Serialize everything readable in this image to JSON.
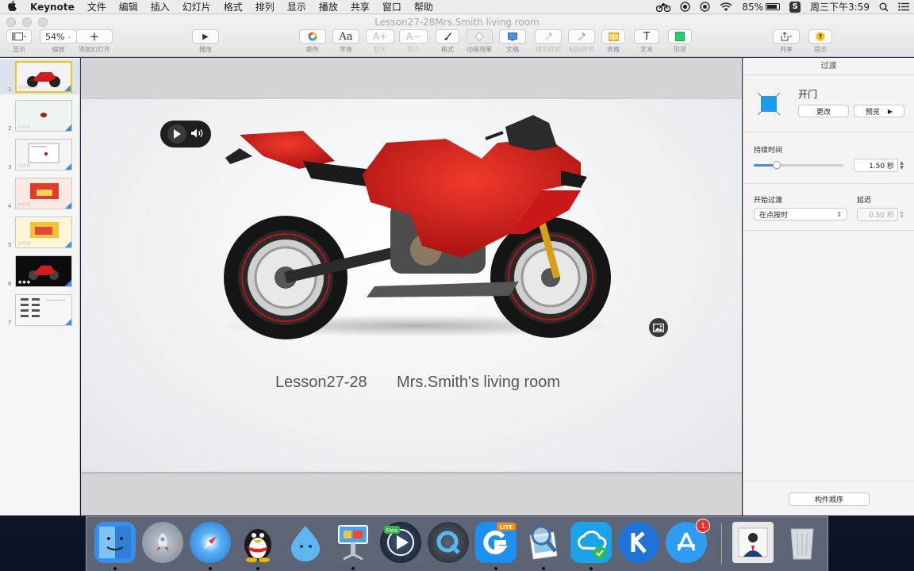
{
  "menubar": {
    "app_name": "Keynote",
    "items": [
      "文件",
      "编辑",
      "插入",
      "幻灯片",
      "格式",
      "排列",
      "显示",
      "播放",
      "共享",
      "窗口",
      "帮助"
    ],
    "battery_percent": "85%",
    "clock": "周三下午3:59"
  },
  "window": {
    "title": "Lesson27-28Mrs.Smith living room"
  },
  "toolbar": {
    "view_label": "显示",
    "zoom_value": "54%",
    "zoom_label": "缩放",
    "add_slide_label": "添加幻灯片",
    "play_label": "播放",
    "color_label": "颜色",
    "font_glyph": "Aa",
    "font_label": "字体",
    "bigger_glyph": "A+",
    "bigger_label": "较大",
    "smaller_glyph": "A−",
    "smaller_label": "较小",
    "format_label": "格式",
    "animate_label": "动画效果",
    "document_label": "文稿",
    "copy_style_label": "拷贝样式",
    "paste_style_label": "粘贴样式",
    "table_label": "表格",
    "text_glyph": "T",
    "text_label": "文本",
    "shape_label": "形状",
    "share_label": "共享",
    "tips_label": "提示"
  },
  "navigator": {
    "slides": [
      {
        "number": "1",
        "kind": "bike-light",
        "selected": true
      },
      {
        "number": "2",
        "kind": "dot",
        "selected": false
      },
      {
        "number": "3",
        "kind": "doc",
        "selected": false
      },
      {
        "number": "4",
        "kind": "red-room",
        "selected": false
      },
      {
        "number": "5",
        "kind": "yellow-room",
        "selected": false
      },
      {
        "number": "6",
        "kind": "bike-dark",
        "selected": false
      },
      {
        "number": "7",
        "kind": "grid",
        "selected": false
      }
    ]
  },
  "slide": {
    "text_lesson": "Lesson27-28",
    "text_title": "Mrs.Smith's living room"
  },
  "inspector": {
    "tab_label": "过渡",
    "transition_name": "开门",
    "change_button": "更改",
    "preview_button": "预览",
    "duration_label": "持续时间",
    "duration_value": "1.50 秒",
    "duration_slider_fraction": 0.25,
    "start_label": "开始过渡",
    "start_value": "在点按时",
    "delay_label": "延迟",
    "delay_value": "0.50 秒",
    "build_order_button": "构件顺序"
  },
  "dock": {
    "apps": [
      {
        "name": "finder",
        "color": "#3b8ee8"
      },
      {
        "name": "launchpad",
        "color": "#9aa4b0"
      },
      {
        "name": "safari",
        "color": "#2f8de4"
      },
      {
        "name": "qq",
        "color": "#f2f2f2"
      },
      {
        "name": "droplet-app",
        "color": "#5fb6ef"
      },
      {
        "name": "keynote",
        "color": "#4aa3f0"
      },
      {
        "name": "media-player-free",
        "color": "#1f2f44"
      },
      {
        "name": "quicktime",
        "color": "#2b3038"
      },
      {
        "name": "browser-lite",
        "color": "#1d8ff0"
      },
      {
        "name": "preview",
        "color": "#8ccbe8"
      },
      {
        "name": "cloud-sync",
        "color": "#1aa3e8"
      },
      {
        "name": "k-app",
        "color": "#145fc2"
      },
      {
        "name": "app-store",
        "color": "#2f9cf3"
      }
    ],
    "app_store_badge": "1"
  }
}
